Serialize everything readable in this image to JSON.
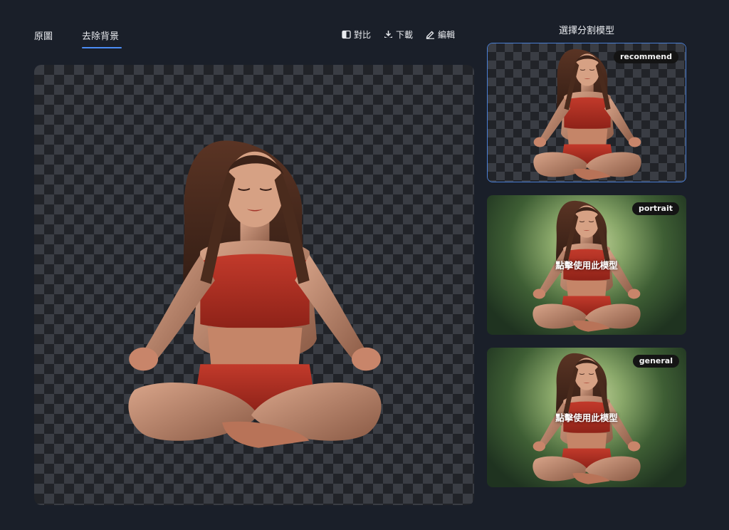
{
  "tabs": [
    {
      "label": "原圖",
      "active": false
    },
    {
      "label": "去除背景",
      "active": true
    }
  ],
  "toolbar": {
    "compare_label": "對比",
    "download_label": "下載",
    "edit_label": "編輯"
  },
  "model_panel": {
    "title": "選擇分割模型",
    "models": [
      {
        "name": "recommend",
        "selected": true,
        "background": "transparent"
      },
      {
        "name": "portrait",
        "selected": false,
        "background": "forest",
        "hover_label": "點擊使用此模型"
      },
      {
        "name": "general",
        "selected": false,
        "background": "forest",
        "hover_label": "點擊使用此模型"
      }
    ]
  },
  "colors": {
    "background": "#1a1f29",
    "accent": "#4b8df5",
    "selected_border": "#4a7fd6",
    "badge_bg": "#141414"
  }
}
